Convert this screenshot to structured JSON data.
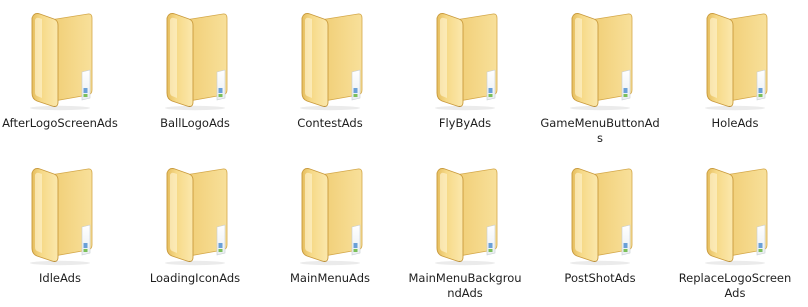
{
  "folders": [
    {
      "label": "AfterLogoScreen​Ads",
      "icon": "folder-icon"
    },
    {
      "label": "BallLogoAds",
      "icon": "folder-icon"
    },
    {
      "label": "ContestAds",
      "icon": "folder-icon"
    },
    {
      "label": "FlyByAds",
      "icon": "folder-icon"
    },
    {
      "label": "GameMenuButto​nAds",
      "icon": "folder-icon"
    },
    {
      "label": "HoleAds",
      "icon": "folder-icon"
    },
    {
      "label": "IdleAds",
      "icon": "folder-icon"
    },
    {
      "label": "LoadingIconAds",
      "icon": "folder-icon"
    },
    {
      "label": "MainMenuAds",
      "icon": "folder-icon"
    },
    {
      "label": "MainMenuBackg​roundAds",
      "icon": "folder-icon"
    },
    {
      "label": "PostShotAds",
      "icon": "folder-icon"
    },
    {
      "label": "ReplaceLogoScre​enAds",
      "icon": "folder-icon"
    }
  ],
  "colors": {
    "folder_light": "#fbe7a4",
    "folder_mid": "#f2cf74",
    "folder_dark": "#d9ac4a",
    "label_text": "#1e1e1e"
  }
}
